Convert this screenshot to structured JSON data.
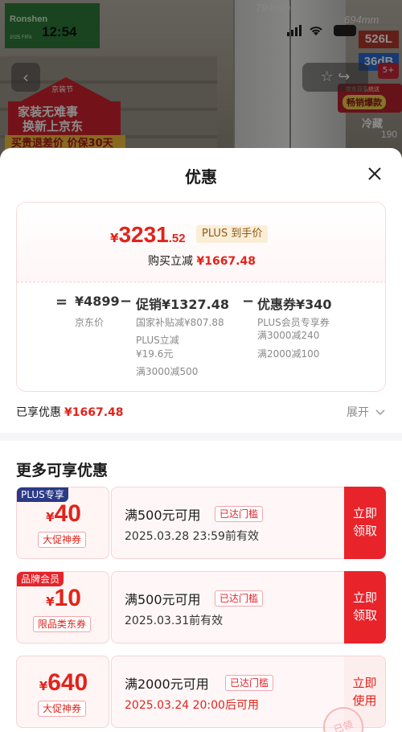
{
  "background": {
    "status_time": "12:54",
    "brand_name": "Ronshen",
    "brand_sub": "2025 FIFA",
    "dim_width": "794mm",
    "dim_depth": "694mm",
    "capacity": "526L",
    "capacity2": "36dB",
    "five_plus": "5+",
    "hot_label": "畅销爆款",
    "hot_sub": "京东双系统送",
    "cold_text": "冷藏",
    "height_partial": "190",
    "promo_house_top": "京装节",
    "promo_line1": "家装无难事",
    "promo_line2": "换新上京东",
    "promo_line3": "买贵退差价 价保30天"
  },
  "sheet": {
    "title": "优惠",
    "price": {
      "currency": "¥",
      "integer": "3231",
      "decimal": ".52",
      "plus_tag": "PLUS 到手价",
      "reduce_label": "购买立减",
      "reduce_value": "¥1667.48"
    },
    "formula": {
      "eq": "=",
      "jd_price_value": "¥4899",
      "jd_price_label": "京东价",
      "minus1": "−",
      "promo_value": "促销¥1327.48",
      "promo_details": [
        "国家补贴减¥807.88",
        "PLUS立减",
        "¥19.6元",
        "满3000减500"
      ],
      "minus2": "−",
      "coupon_value": "优惠券¥340",
      "coupon_details": [
        "PLUS会员专享券",
        "满3000减240",
        "满2000减100"
      ]
    },
    "enjoyed_label": "已享优惠",
    "enjoyed_value": "¥1667.48",
    "expand_label": "展开",
    "more_title": "更多可享优惠",
    "coupons": [
      {
        "badge": "PLUS专享",
        "currency": "¥",
        "amount": "40",
        "type": "大促神券",
        "condition": "满500元可用",
        "reach": "已达门槛",
        "date": "2025.03.28 23:59前有效",
        "action": [
          "立即",
          "领取"
        ]
      },
      {
        "badge": "品牌会员",
        "currency": "¥",
        "amount": "10",
        "type": "限品类东券",
        "condition": "满500元可用",
        "reach": "已达门槛",
        "date": "2025.03.31前有效",
        "action": [
          "立即",
          "领取"
        ]
      },
      {
        "badge": "",
        "currency": "¥",
        "amount": "640",
        "type": "大促神券",
        "condition": "满2000元可用",
        "reach": "已达门槛",
        "date": "2025.03.24 20:00后可用",
        "action": [
          "立即",
          "使用"
        ],
        "stamp": "已领"
      }
    ]
  },
  "colors": {
    "accent_red": "#e2231a",
    "plus_blue": "#2b3a86",
    "tag_gold_bg": "#fbeed6"
  }
}
